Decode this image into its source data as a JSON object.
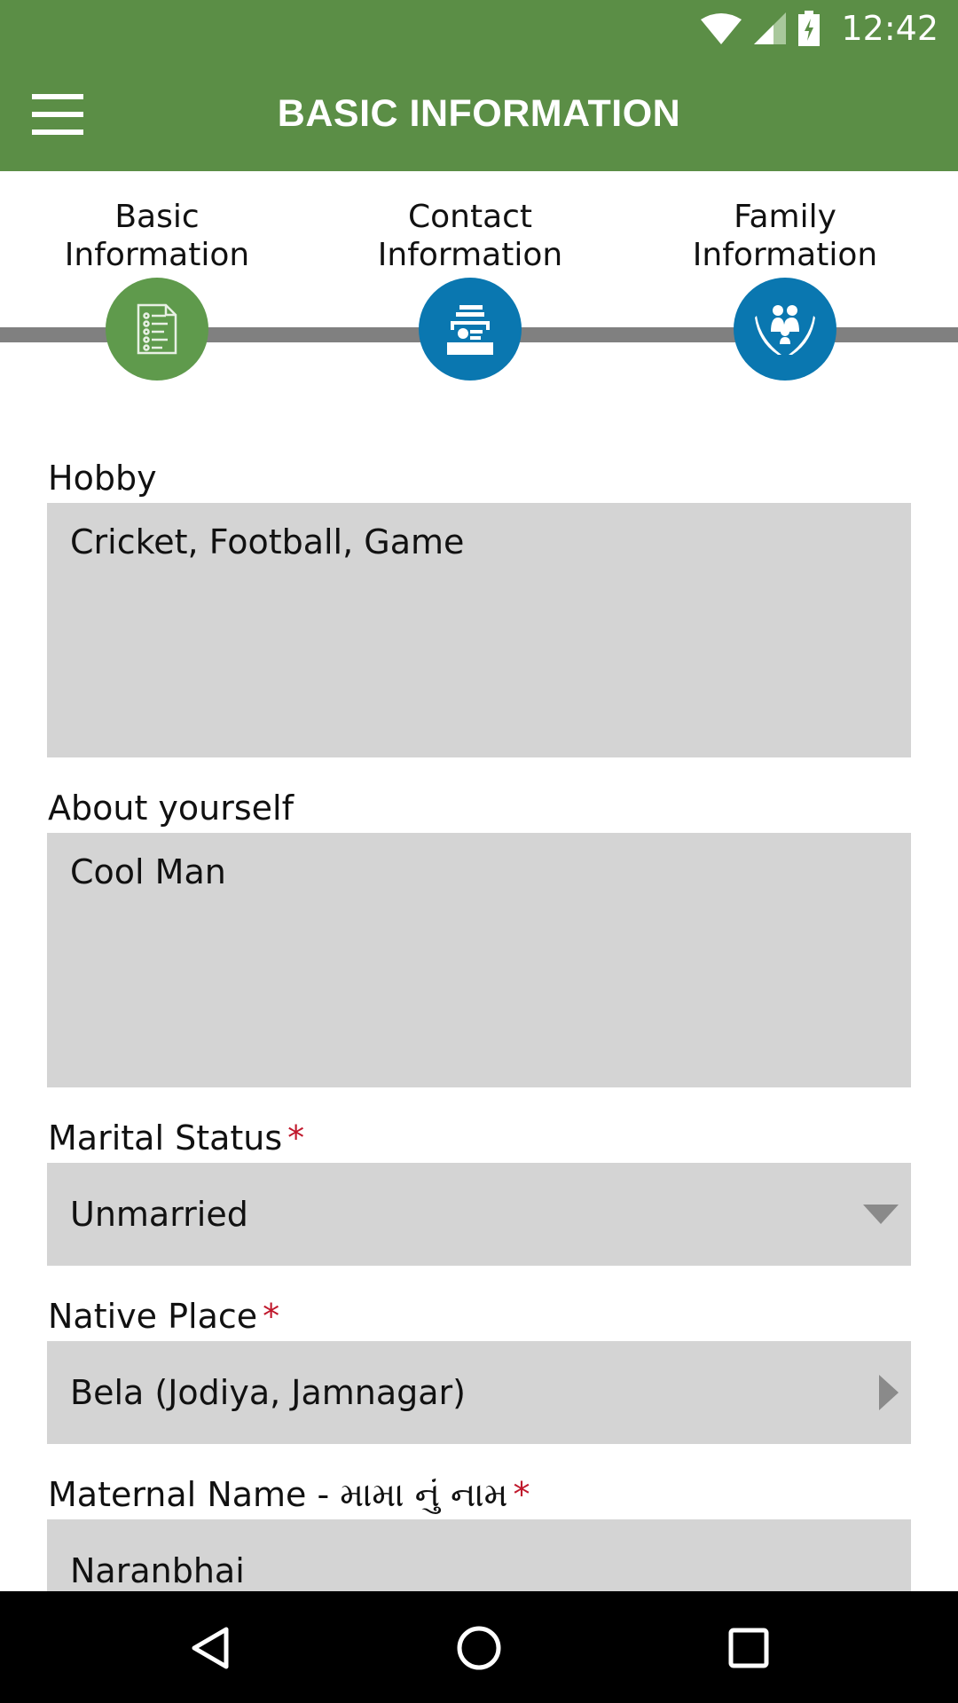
{
  "status_bar": {
    "time": "12:42",
    "icons": [
      "wifi-icon",
      "cellular-signal-icon",
      "battery-charging-icon"
    ]
  },
  "app_bar": {
    "menu_icon": "hamburger-menu-icon",
    "title": "BASIC INFORMATION",
    "background_color": "#5b8e46"
  },
  "steps": [
    {
      "label_line1": "Basic",
      "label_line2": "Information",
      "icon": "document-list-icon",
      "color": "#5f9a4c",
      "active": true
    },
    {
      "label_line1": "Contact",
      "label_line2": "Information",
      "icon": "contact-card-icon",
      "color": "#0a77b0",
      "active": false
    },
    {
      "label_line1": "Family",
      "label_line2": "Information",
      "icon": "family-care-icon",
      "color": "#0a77b0",
      "active": false
    }
  ],
  "form": {
    "hobby": {
      "label": "Hobby",
      "value": "Cricket, Football, Game"
    },
    "about": {
      "label": "About yourself",
      "value": "Cool Man"
    },
    "marital_status": {
      "label": "Marital Status",
      "required": "*",
      "value": "Unmarried"
    },
    "native_place": {
      "label": "Native Place",
      "required": "*",
      "value": "Bela (Jodiya, Jamnagar)"
    },
    "maternal_name": {
      "label": "Maternal Name - મામા નું નામ",
      "required": "*",
      "value": "Naranbhai"
    }
  },
  "nav_bar": {
    "back": "back-icon",
    "home": "home-icon",
    "recents": "recents-icon"
  }
}
